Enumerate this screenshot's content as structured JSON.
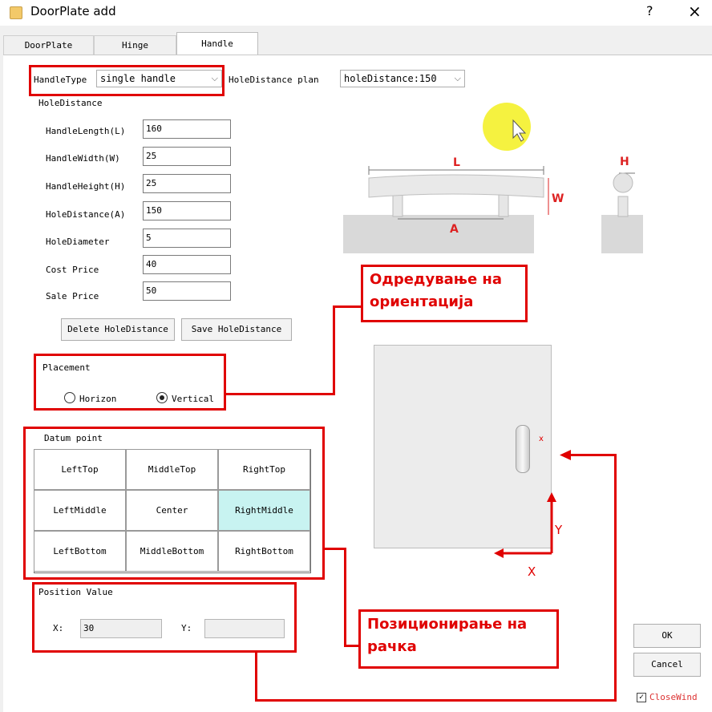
{
  "window": {
    "title": "DoorPlate add",
    "help": "?",
    "close": "×"
  },
  "tabs": [
    "DoorPlate",
    "Hinge",
    "Handle"
  ],
  "handle_type": {
    "label": "HandleType",
    "value": "single handle"
  },
  "hole_plan": {
    "label": "HoleDistance plan",
    "value": "holeDistance:150"
  },
  "section_hole": "HoleDistance",
  "fields": [
    {
      "label": "HandleLength(L)",
      "value": "160"
    },
    {
      "label": "HandleWidth(W)",
      "value": "25"
    },
    {
      "label": "HandleHeight(H)",
      "value": "25"
    },
    {
      "label": "HoleDistance(A)",
      "value": "150"
    },
    {
      "label": "HoleDiameter",
      "value": "5"
    },
    {
      "label": "Cost Price",
      "value": "40"
    },
    {
      "label": "Sale Price",
      "value": "50"
    }
  ],
  "buttons": {
    "delete": "Delete HoleDistance",
    "save": "Save HoleDistance",
    "ok": "OK",
    "cancel": "Cancel"
  },
  "placement": {
    "title": "Placement",
    "horizon": "Horizon",
    "vertical": "Vertical",
    "selected": "Vertical"
  },
  "datum": {
    "title": "Datum point",
    "cells": [
      "LeftTop",
      "MiddleTop",
      "RightTop",
      "LeftMiddle",
      "Center",
      "RightMiddle",
      "LeftBottom",
      "MiddleBottom",
      "RightBottom"
    ],
    "selected": "RightMiddle"
  },
  "position": {
    "title": "Position Value",
    "x_label": "X:",
    "x_value": "30",
    "y_label": "Y:",
    "y_value": ""
  },
  "diagram": {
    "L": "L",
    "W": "W",
    "A": "A",
    "H": "H",
    "x_small": "x",
    "axis_x": "X",
    "axis_y": "Y"
  },
  "close_window": "CloseWind",
  "annotations": {
    "orientation": "Одредување на ориентација",
    "orientation_l1": "Одредување на",
    "orientation_l2": "ориентација",
    "positioning_l1": "Позиционирање на",
    "positioning_l2": "рачка"
  },
  "colors": {
    "annotation_red": "#e00000",
    "selected_cell": "#c8f3f1",
    "cursor_highlight": "#f3f01e"
  }
}
